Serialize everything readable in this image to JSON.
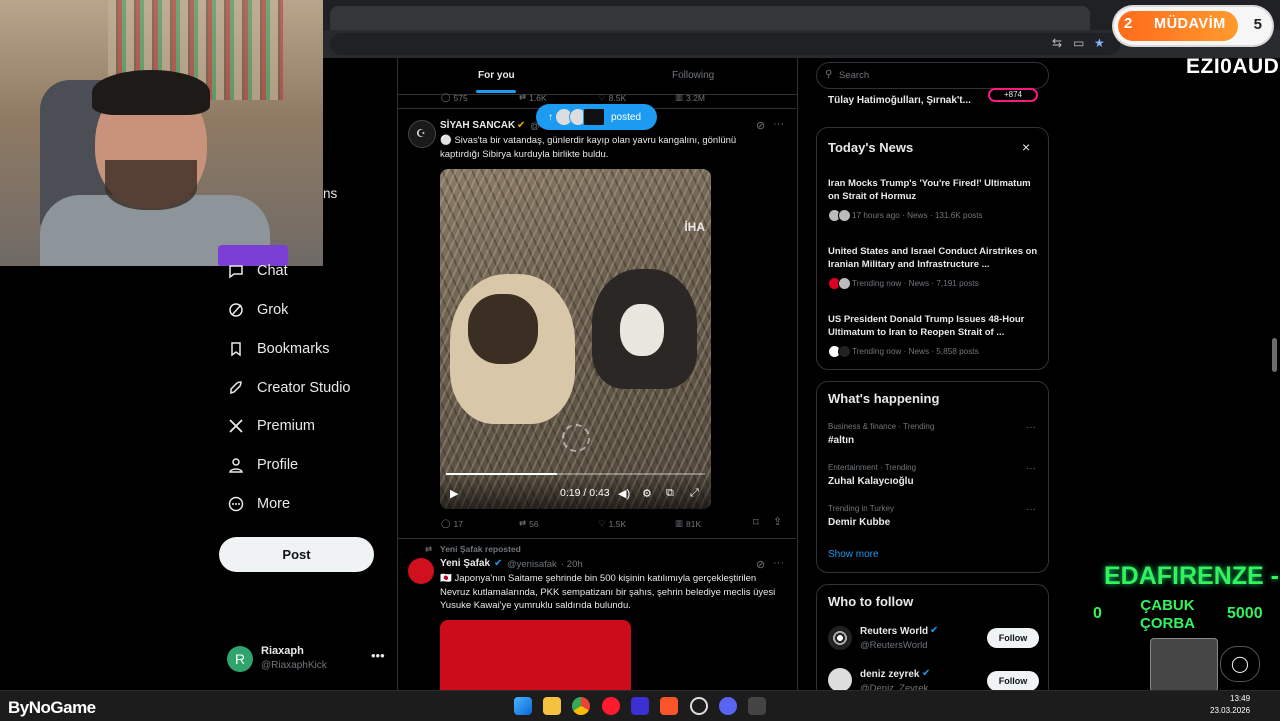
{
  "overlay": {
    "badge_left": "2",
    "badge_name": "MÜDAVİM",
    "badge_right": "5",
    "streamer": "EZI0AUD",
    "alert_title": "EDAFIRENZE -",
    "alert_item_line1": "ÇABUK",
    "alert_item_line2": "ÇORBA",
    "alert_left": "0",
    "alert_right": "5000",
    "brand": "ByNoGame"
  },
  "sidebar": {
    "partial_label": "ns",
    "items": [
      {
        "label": "Chat",
        "icon": "chat-icon"
      },
      {
        "label": "Grok",
        "icon": "grok-icon"
      },
      {
        "label": "Bookmarks",
        "icon": "bookmark-icon"
      },
      {
        "label": "Creator Studio",
        "icon": "rocket-icon"
      },
      {
        "label": "Premium",
        "icon": "x-logo-icon"
      },
      {
        "label": "Profile",
        "icon": "person-icon"
      },
      {
        "label": "More",
        "icon": "more-circle-icon"
      }
    ],
    "post_label": "Post",
    "account": {
      "name": "Riaxaph",
      "handle": "@RiaxaphKick",
      "initial": "R"
    }
  },
  "feed": {
    "tabs": [
      {
        "label": "For you"
      },
      {
        "label": "Following"
      }
    ],
    "prev_post_stats": {
      "replies": "575",
      "reposts": "1.6K",
      "likes": "8.5K",
      "views": "3.2M"
    },
    "pill_label": "posted",
    "tweet1": {
      "name": "SİYAH SANCAK",
      "handle": "@",
      "text": "⚪ Sivas'ta bir vatandaş, günlerdir kayıp olan yavru kangalını, gönlünü kaptırdığı Sibirya kurduyla birlikte buldu.",
      "video_time": "0:19 / 0:43",
      "watermark": "İHA",
      "stats": {
        "replies": "17",
        "reposts": "56",
        "likes": "1.5K",
        "views": "81K"
      }
    },
    "tweet2": {
      "reposted_by": "Yeni Şafak reposted",
      "name": "Yeni Şafak",
      "handle": "@yenisafak",
      "time": "· 20h",
      "text": "🇯🇵 Japonya'nın Saitame şehrinde bin 500 kişinin katılımıyla gerçekleştirilen Nevruz kutlamalarında, PKK sempatizanı bir şahıs, şehrin belediye meclis üyesi Yusuke Kawai'ye yumruklu saldırıda bulundu."
    }
  },
  "right": {
    "search_placeholder": "Search",
    "top_partial": "Tülay Hatimoğulları, Şırnak't...",
    "top_partial_badge": "+874",
    "news": {
      "title": "Today's News",
      "items": [
        {
          "headline": "Iran Mocks Trump's 'You're Fired!' Ultimatum on Strait of Hormuz",
          "meta": "17 hours ago · News · 131.6K posts"
        },
        {
          "headline": "United States and Israel Conduct Airstrikes on Iranian Military and Infrastructure ...",
          "meta": "Trending now · News · 7,191 posts"
        },
        {
          "headline": "US President Donald Trump Issues 48-Hour Ultimatum to Iran to Reopen Strait of ...",
          "meta": "Trending now · News · 5,858 posts"
        }
      ]
    },
    "happening": {
      "title": "What's happening",
      "items": [
        {
          "context": "Business & finance · Trending",
          "topic": "#altın"
        },
        {
          "context": "Entertainment · Trending",
          "topic": "Zuhal Kalaycıoğlu"
        },
        {
          "context": "Trending in Turkey",
          "topic": "Demir Kubbe"
        }
      ],
      "show_more": "Show more"
    },
    "follow": {
      "title": "Who to follow",
      "items": [
        {
          "name": "Reuters World",
          "handle": "@ReutersWorld",
          "button": "Follow"
        },
        {
          "name": "deniz zeyrek",
          "handle": "@Deniz_Zeyrek",
          "button": "Follow"
        }
      ]
    }
  },
  "taskbar": {
    "time": "13:49",
    "date": "23.03.2026"
  },
  "colors": {
    "accent": "#1d9bf0",
    "bg": "#000000",
    "border": "#2f3336",
    "alert_green": "#34f25e",
    "badge_orange": "#ff7a1f"
  }
}
